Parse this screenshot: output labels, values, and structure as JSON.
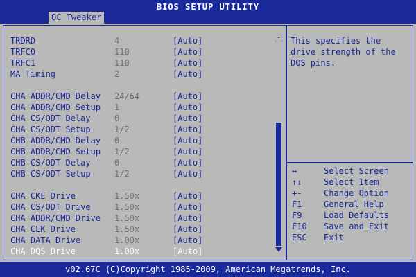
{
  "title": "BIOS SETUP UTILITY",
  "tab": "OC Tweaker",
  "settings": [
    {
      "name": "TRDRD",
      "value": "4",
      "option": "[Auto]"
    },
    {
      "name": "TRFC0",
      "value": "110",
      "option": "[Auto]"
    },
    {
      "name": "TRFC1",
      "value": "110",
      "option": "[Auto]"
    },
    {
      "name": "MA Timing",
      "value": "2",
      "option": "[Auto]"
    },
    {
      "name": "CHA ADDR/CMD Delay",
      "value": "24/64",
      "option": "[Auto]"
    },
    {
      "name": "CHA ADDR/CMD Setup",
      "value": "1",
      "option": "[Auto]"
    },
    {
      "name": "CHA CS/ODT Delay",
      "value": "0",
      "option": "[Auto]"
    },
    {
      "name": "CHA CS/ODT Setup",
      "value": "1/2",
      "option": "[Auto]"
    },
    {
      "name": "CHB ADDR/CMD Delay",
      "value": "0",
      "option": "[Auto]"
    },
    {
      "name": "CHB ADDR/CMD Setup",
      "value": "1/2",
      "option": "[Auto]"
    },
    {
      "name": "CHB CS/ODT Delay",
      "value": "0",
      "option": "[Auto]"
    },
    {
      "name": "CHB CS/ODT Setup",
      "value": "1/2",
      "option": "[Auto]"
    },
    {
      "name": "CHA CKE Drive",
      "value": "1.50x",
      "option": "[Auto]"
    },
    {
      "name": "CHA CS/ODT Drive",
      "value": "1.50x",
      "option": "[Auto]"
    },
    {
      "name": "CHA ADDR/CMD Drive",
      "value": "1.50x",
      "option": "[Auto]"
    },
    {
      "name": "CHA CLK Drive",
      "value": "1.50x",
      "option": "[Auto]"
    },
    {
      "name": "CHA DATA Drive",
      "value": "1.00x",
      "option": "[Auto]"
    },
    {
      "name": "CHA DQS Drive",
      "value": "1.00x",
      "option": "[Auto]"
    }
  ],
  "help": "This specifies the drive strength of the DQS pins.",
  "keys": [
    {
      "key": "↔",
      "desc": "Select Screen"
    },
    {
      "key": "↑↓",
      "desc": "Select Item"
    },
    {
      "key": "+-",
      "desc": "Change Option"
    },
    {
      "key": "F1",
      "desc": "General Help"
    },
    {
      "key": "F9",
      "desc": "Load Defaults"
    },
    {
      "key": "F10",
      "desc": "Save and Exit"
    },
    {
      "key": "ESC",
      "desc": "Exit"
    }
  ],
  "footer": "v02.67C (C)Copyright 1985-2009, American Megatrends, Inc.",
  "colors": {
    "bios_blue": "#1a2a9a",
    "bios_gray": "#b9b9b9",
    "value_gray": "#6e6e6e",
    "selected": "#ffffff"
  }
}
